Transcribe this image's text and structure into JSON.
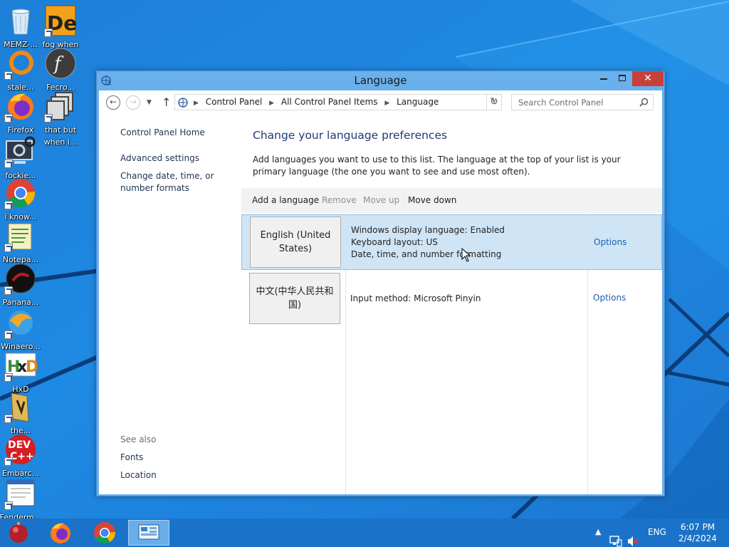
{
  "desktop": {
    "icons": [
      {
        "label": "MEMZ-...",
        "icon": "recycle-bin-icon"
      },
      {
        "label": "fog when",
        "icon": "de-app-icon"
      },
      {
        "label": "stale...",
        "icon": "orange-ring-icon"
      },
      {
        "label": "Fecro...",
        "icon": "flash-player-icon"
      },
      {
        "label": "Firefox",
        "icon": "firefox-icon"
      },
      {
        "label": "that but when i...",
        "icon": "stacked-windows-icon"
      },
      {
        "label": "fockie...",
        "icon": "computer-gear-icon"
      },
      {
        "label": "i know...",
        "icon": "chrome-icon"
      },
      {
        "label": "Notepa...",
        "icon": "notepad-icon"
      },
      {
        "label": "Panana...",
        "icon": "dark-circle-icon"
      },
      {
        "label": "Winaero...",
        "icon": "winaero-icon"
      },
      {
        "label": "HxD",
        "icon": "hxd-icon"
      },
      {
        "label": "the...",
        "icon": "winamp-icon"
      },
      {
        "label": "Embarc...",
        "icon": "dev-cpp-icon"
      },
      {
        "label": "Fenderm...",
        "icon": "document-window-icon"
      }
    ]
  },
  "window": {
    "title": "Language",
    "close_glyph": "✕",
    "breadcrumbs": [
      "Control Panel",
      "All Control Panel Items",
      "Language"
    ],
    "search_placeholder": "Search Control Panel"
  },
  "left_pane": {
    "home": "Control Panel Home",
    "advanced": "Advanced settings",
    "datetime": "Change date, time, or number formats",
    "see_also": "See also",
    "fonts": "Fonts",
    "location": "Location"
  },
  "main": {
    "heading": "Change your language preferences",
    "description": "Add languages you want to use to this list. The language at the top of your list is your primary language (the one you want to see and use most often).",
    "toolbar": {
      "add": "Add a language",
      "remove": "Remove",
      "move_up": "Move up",
      "move_down": "Move down"
    },
    "languages": [
      {
        "name": "English (United States)",
        "info": [
          "Windows display language: Enabled",
          "Keyboard layout: US",
          "Date, time, and number formatting"
        ],
        "options": "Options",
        "selected": true
      },
      {
        "name": "中文(中华人民共和国)",
        "info": [
          "Input method: Microsoft Pinyin"
        ],
        "options": "Options",
        "selected": false
      }
    ]
  },
  "taskbar": {
    "items": [
      "start-orb-icon",
      "firefox-icon",
      "chrome-icon",
      "control-panel-icon"
    ],
    "tray": {
      "language": "ENG",
      "time": "6:07 PM",
      "date": "2/4/2024"
    }
  }
}
